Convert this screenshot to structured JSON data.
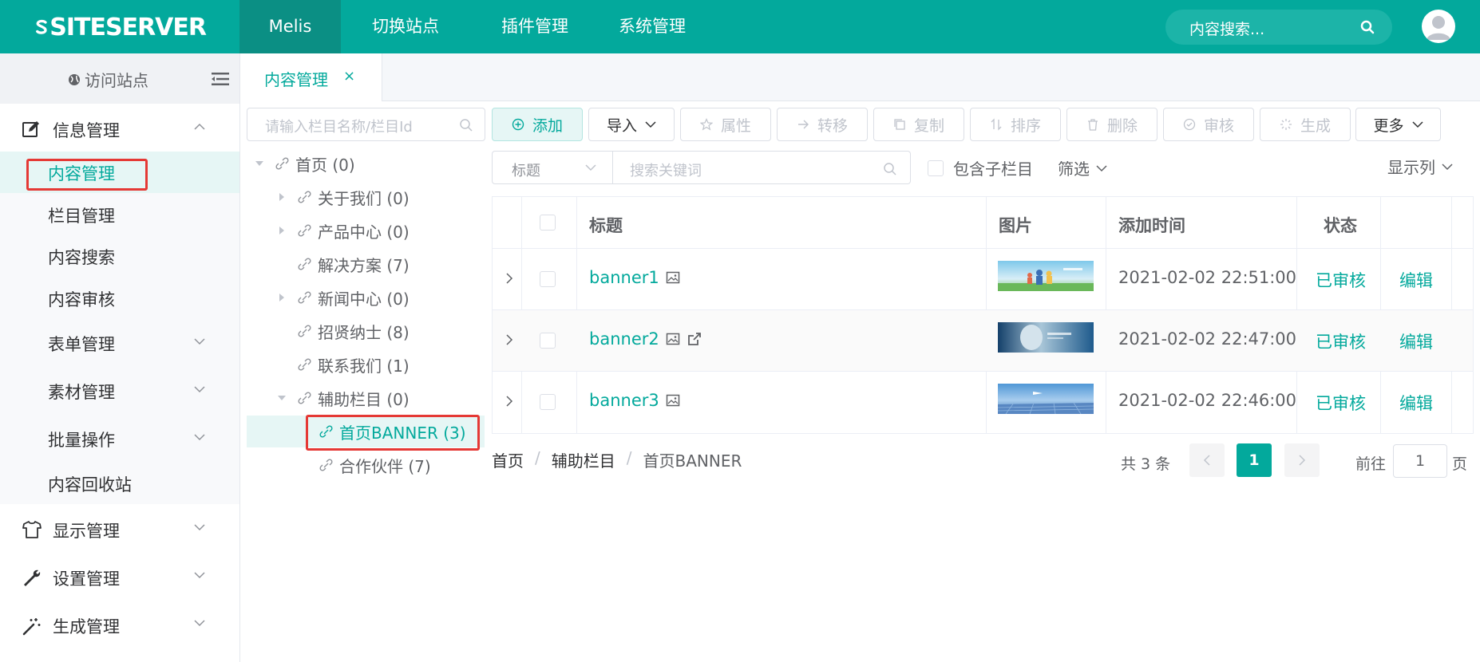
{
  "app": {
    "logo_text": "SITESERVER"
  },
  "topnav": {
    "items": [
      "Melis",
      "切换站点",
      "插件管理",
      "系统管理"
    ],
    "search_placeholder": "内容搜索..."
  },
  "sidebar": {
    "visit_site": "访问站点",
    "groups": [
      {
        "label": "信息管理",
        "icon": "edit-icon",
        "expanded": true
      },
      {
        "label": "显示管理",
        "icon": "tshirt-icon"
      },
      {
        "label": "设置管理",
        "icon": "wrench-icon"
      },
      {
        "label": "生成管理",
        "icon": "magic-wand-icon"
      }
    ],
    "sub_items": [
      "内容管理",
      "栏目管理",
      "内容搜索",
      "内容审核",
      "表单管理",
      "素材管理",
      "批量操作",
      "内容回收站"
    ],
    "active_sub": "内容管理"
  },
  "tabs": [
    {
      "label": "内容管理",
      "close": "×"
    }
  ],
  "tree": {
    "search_placeholder": "请输入栏目名称/栏目Id",
    "nodes": [
      "首页 (0)",
      "关于我们 (0)",
      "产品中心 (0)",
      "解决方案 (7)",
      "新闻中心 (0)",
      "招贤纳士 (8)",
      "联系我们 (1)",
      "辅助栏目 (0)",
      "首页BANNER (3)",
      "合作伙伴 (7)"
    ]
  },
  "toolbar": {
    "add": "添加",
    "import": "导入",
    "attributes": "属性",
    "transfer": "转移",
    "copy": "复制",
    "sort": "排序",
    "delete": "删除",
    "review": "审核",
    "generate": "生成",
    "more": "更多"
  },
  "filter": {
    "field": "标题",
    "keyword_placeholder": "搜索关键词",
    "include_sub": "包含子栏目",
    "filter": "筛选",
    "columns": "显示列"
  },
  "table": {
    "headers": {
      "title": "标题",
      "image": "图片",
      "added": "添加时间",
      "status": "状态"
    },
    "rows": [
      {
        "title": "banner1",
        "time": "2021-02-02 22:51:00",
        "status": "已审核",
        "edit": "编辑"
      },
      {
        "title": "banner2",
        "time": "2021-02-02 22:47:00",
        "status": "已审核",
        "edit": "编辑"
      },
      {
        "title": "banner3",
        "time": "2021-02-02 22:46:00",
        "status": "已审核",
        "edit": "编辑"
      }
    ]
  },
  "breadcrumb": [
    "首页",
    "辅助栏目",
    "首页BANNER"
  ],
  "pagination": {
    "total": "共 3 条",
    "current": "1",
    "goto_prefix": "前往",
    "goto_value": "1",
    "goto_suffix": "页"
  },
  "colors": {
    "primary": "#03a99c",
    "highlight": "#e53935"
  }
}
